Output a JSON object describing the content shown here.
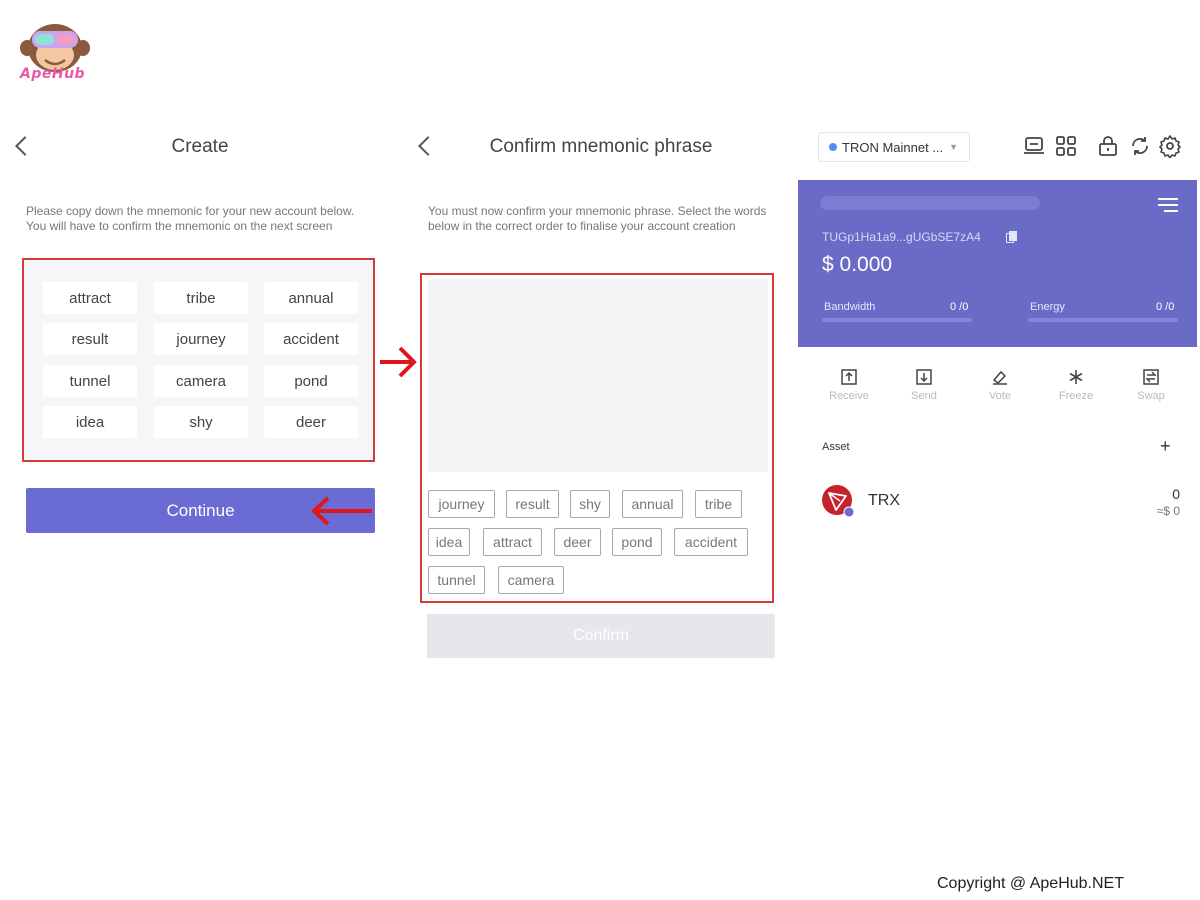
{
  "brand": {
    "logo_text": "ApeHub",
    "copyright": "Copyright @ ApeHub.NET"
  },
  "create_screen": {
    "title": "Create",
    "description": "Please copy down the mnemonic for your new account below. You will have to confirm the mnemonic on the next screen",
    "words": [
      "attract",
      "tribe",
      "annual",
      "result",
      "journey",
      "accident",
      "tunnel",
      "camera",
      "pond",
      "idea",
      "shy",
      "deer"
    ],
    "continue_label": "Continue"
  },
  "confirm_screen": {
    "title": "Confirm mnemonic phrase",
    "description": "You must now confirm your mnemonic phrase. Select the words below in the correct order to finalise your account creation",
    "chips": [
      "journey",
      "result",
      "shy",
      "annual",
      "tribe",
      "idea",
      "attract",
      "deer",
      "pond",
      "accident",
      "tunnel",
      "camera"
    ],
    "confirm_label": "Confirm"
  },
  "wallet_screen": {
    "network": "TRON Mainnet ...",
    "address": "TUGp1Ha1a9...gUGbSE7zA4",
    "balance": "$ 0.000",
    "bandwidth_label": "Bandwidth",
    "bandwidth_value": "0 /0",
    "energy_label": "Energy",
    "energy_value": "0 /0",
    "actions": [
      "Receive",
      "Send",
      "Vote",
      "Freeze",
      "Swap"
    ],
    "asset_label": "Asset",
    "asset_add": "+",
    "asset": {
      "symbol": "TRX",
      "amount": "0",
      "fiat": "≈$ 0"
    }
  },
  "colors": {
    "accent": "#6a6bd3",
    "highlight": "#d33b3b",
    "card": "#6a6bc6"
  }
}
